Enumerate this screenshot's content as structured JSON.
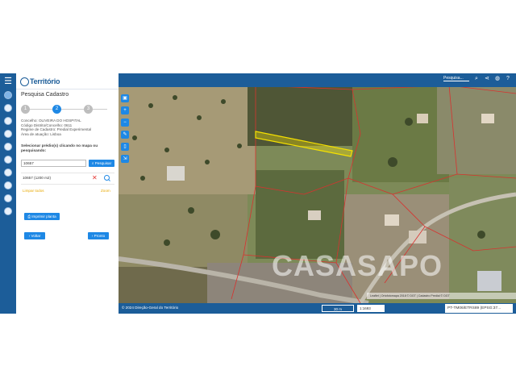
{
  "app": {
    "logo_text": "Território"
  },
  "rail": {
    "icons": [
      "home-icon",
      "layers-icon",
      "info-icon",
      "measure-icon",
      "refresh-icon",
      "print-icon",
      "settings-icon",
      "pin-icon",
      "globe-icon",
      "location-icon"
    ]
  },
  "panel": {
    "title": "Pesquisa Cadastro",
    "steps": [
      "1",
      "2",
      "3"
    ],
    "active_step": "2",
    "info": [
      "Concelho: OLIVEIRA DO HOSPITAL",
      "Código Distrito/Concelho: 0611",
      "Regime de Cadastro: Predial Experimental",
      "Área de atuação: Lisboa"
    ],
    "prompt": "Selecionar prédio(s) clicando no mapa ou pesquisando:",
    "search_value": "10657",
    "search_button": "Pesquisar",
    "result": "10657 (1200 m2)",
    "clear_link": "Limpar todos",
    "zoom_link": "Zoom",
    "print_button": "Imprimir planta",
    "back_button": "Voltar",
    "next_button": "Pronto"
  },
  "map": {
    "search_label": "Pesquisa...",
    "copyright": "© 2024 Direção-Geral do Território",
    "scale_label": "30 m",
    "ratio": "1:1693",
    "crs": "PT-TM06/ETRS89 (EPSG:37...",
    "attribution": "Leaflet | Ortofotomapa 2018 © DGT | Cadastro Predial © DGT",
    "watermark": "CASASAPO"
  },
  "colors": {
    "brand": "#1c5d99",
    "button": "#1e88e5",
    "link": "#e8a800",
    "highlight": "#f5e000",
    "parcel": "#d8322f"
  }
}
